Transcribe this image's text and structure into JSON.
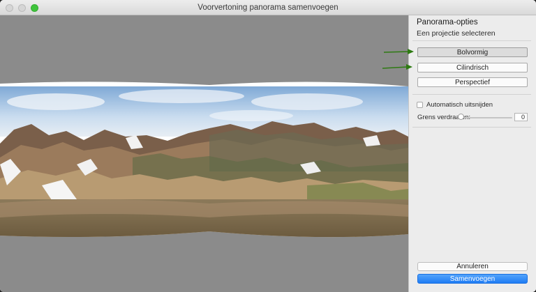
{
  "window": {
    "title": "Voorvertoning panorama samenvoegen"
  },
  "panel": {
    "title": "Panorama-opties",
    "subtitle": "Een projectie selecteren",
    "projections": [
      {
        "label": "Bolvormig",
        "selected": true
      },
      {
        "label": "Cilindrisch",
        "selected": false
      },
      {
        "label": "Perspectief",
        "selected": false
      }
    ],
    "auto_crop_label": "Automatisch uitsnijden",
    "auto_crop_checked": false,
    "boundary_warp_label": "Grens verdraaien:",
    "boundary_warp_value": "0",
    "cancel_label": "Annuleren",
    "merge_label": "Samenvoegen"
  },
  "preview": {
    "image": "panorama-mountain-landscape"
  },
  "annotations": {
    "arrow_color": "#2e7a12",
    "arrows": [
      "arrow-pointing-bolvormig",
      "arrow-pointing-cilindrisch"
    ]
  },
  "colors": {
    "accent": "#1f7cf4",
    "preview_background": "#8b8b8b",
    "panel_background": "#ececec"
  }
}
